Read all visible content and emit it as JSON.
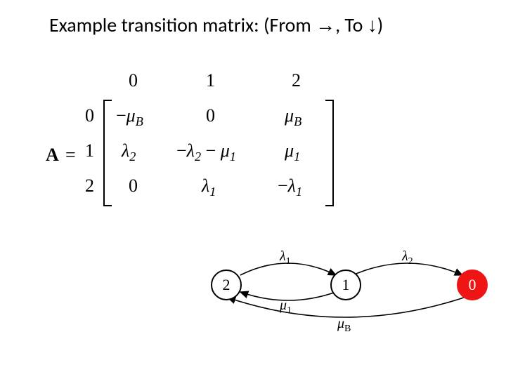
{
  "title": {
    "prefix": "Example transition matrix: (From ",
    "mid": ", To ",
    "suffix": ")",
    "arrow_right": "→",
    "arrow_down": "↓"
  },
  "matrix": {
    "symbol": "A",
    "eq": "=",
    "col_headers": [
      "0",
      "1",
      "2"
    ],
    "row_headers": [
      "0",
      "1",
      "2"
    ],
    "cells": {
      "r0c0_a": "−",
      "r0c0_b": "μ",
      "r0c0_s": "B",
      "r0c1": "0",
      "r0c2_b": "μ",
      "r0c2_s": "B",
      "r1c0_b": "λ",
      "r1c0_s": "2",
      "r1c1_a": "−",
      "r1c1_b": "λ",
      "r1c1_s": "2",
      "r1c1_m": " − ",
      "r1c1_d": "μ",
      "r1c1_ds": "1",
      "r1c2_b": "μ",
      "r1c2_s": "1",
      "r2c0": "0",
      "r2c1_b": "λ",
      "r2c1_s": "1",
      "r2c2_a": "−",
      "r2c2_b": "λ",
      "r2c2_s": "1"
    }
  },
  "diagram": {
    "nodes": {
      "n2": "2",
      "n1": "1",
      "n0": "0"
    },
    "edges": {
      "e21_b": "λ",
      "e21_s": "1",
      "e10_b": "λ",
      "e10_s": "2",
      "e12_b": "μ",
      "e12_s": "1",
      "e02_b": "μ",
      "e02_s": "B"
    }
  }
}
